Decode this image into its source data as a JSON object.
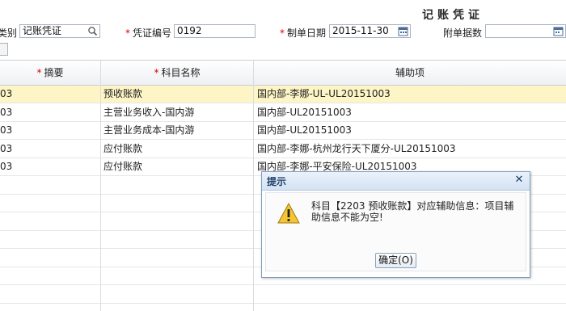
{
  "header": {
    "title": "记账凭证",
    "voucher_type_label": "类别",
    "voucher_type_value": "记账凭证",
    "voucher_no_label": "凭证编号",
    "voucher_no_value": "0192",
    "date_label": "制单日期",
    "date_value": "2015-11-30",
    "attachments_label": "附单据数",
    "attachments_value": "",
    "required_mark": "*"
  },
  "grid": {
    "columns": {
      "summary": "摘要",
      "account": "科目名称",
      "auxiliary": "辅助项"
    },
    "rows": [
      {
        "summary": "03",
        "account": "预收账款",
        "auxiliary": "国内部-李娜-UL-UL20151003",
        "selected": true
      },
      {
        "summary": "03",
        "account": "主营业务收入-国内游",
        "auxiliary": "国内部-UL20151003",
        "selected": false
      },
      {
        "summary": "03",
        "account": "主营业务成本-国内游",
        "auxiliary": "国内部-UL20151003",
        "selected": false
      },
      {
        "summary": "03",
        "account": "应付账款",
        "auxiliary": "国内部-李娜-杭州龙行天下厦分-UL20151003",
        "selected": false
      },
      {
        "summary": "03",
        "account": "应付账款",
        "auxiliary": "国内部-李娜-平安保险-UL20151003",
        "selected": false
      }
    ]
  },
  "dialog": {
    "title": "提示",
    "message": "科目【2203 预收账款】对应辅助信息：项目辅助信息不能为空!",
    "ok_label": "确定(O)",
    "icon": "warning-icon"
  },
  "colors": {
    "selected_row": "#fdf5c6",
    "required": "#e00000",
    "dialog_title": "#1e3f66"
  }
}
